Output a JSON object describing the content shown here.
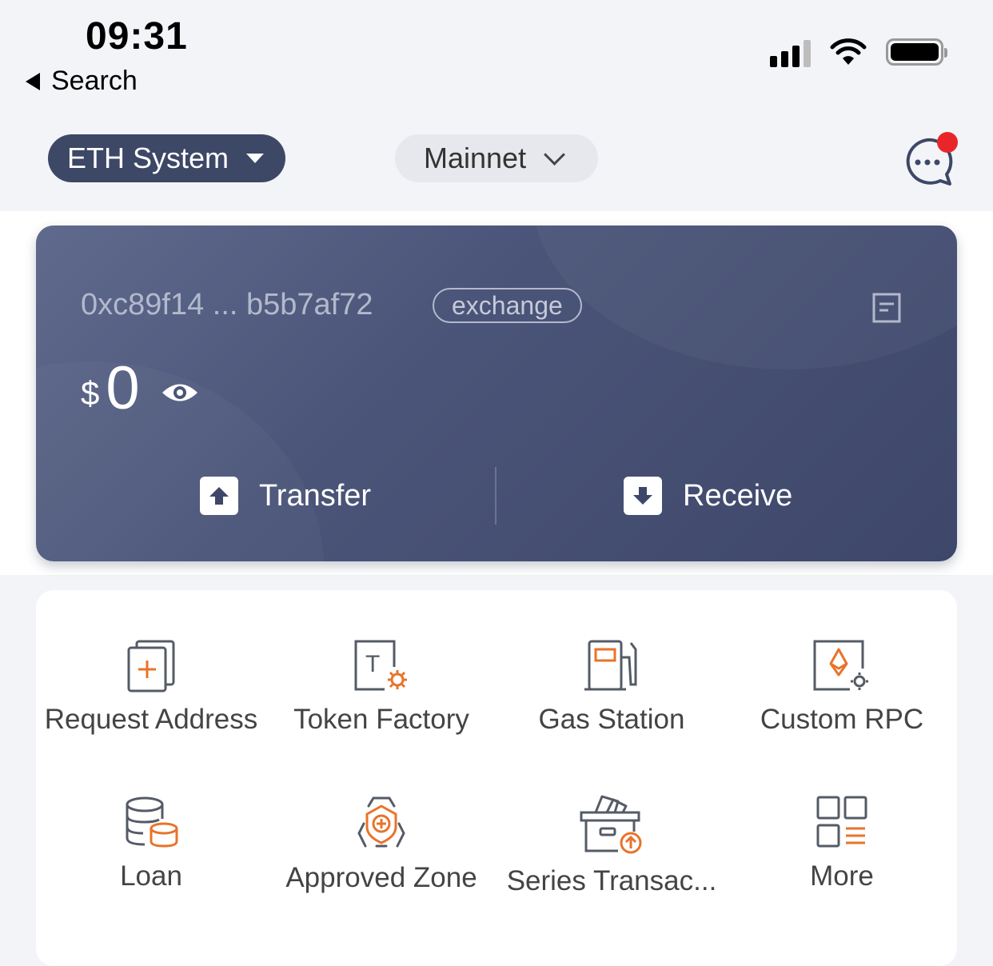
{
  "status_bar": {
    "time": "09:31",
    "back_label": "Search"
  },
  "header": {
    "system_selector": "ETH System",
    "network_selector": "Mainnet",
    "message_has_notification": true
  },
  "wallet": {
    "address": "0xc89f14 ... b5b7af72",
    "tag": "exchange",
    "currency_symbol": "$",
    "balance": "0",
    "transfer_label": "Transfer",
    "receive_label": "Receive"
  },
  "features": [
    {
      "label": "Request Address",
      "icon": "request-address-icon"
    },
    {
      "label": "Token Factory",
      "icon": "token-factory-icon"
    },
    {
      "label": "Gas Station",
      "icon": "gas-station-icon"
    },
    {
      "label": "Custom RPC",
      "icon": "custom-rpc-icon"
    },
    {
      "label": "Loan",
      "icon": "loan-icon"
    },
    {
      "label": "Approved Zone",
      "icon": "approved-zone-icon"
    },
    {
      "label": "Series Transac...",
      "icon": "series-transaction-icon"
    },
    {
      "label": "More",
      "icon": "more-grid-icon"
    }
  ],
  "colors": {
    "accent": "#e8732a",
    "icon_gray": "#555b66",
    "card": "#4b5579",
    "notification": "#e8262a"
  }
}
